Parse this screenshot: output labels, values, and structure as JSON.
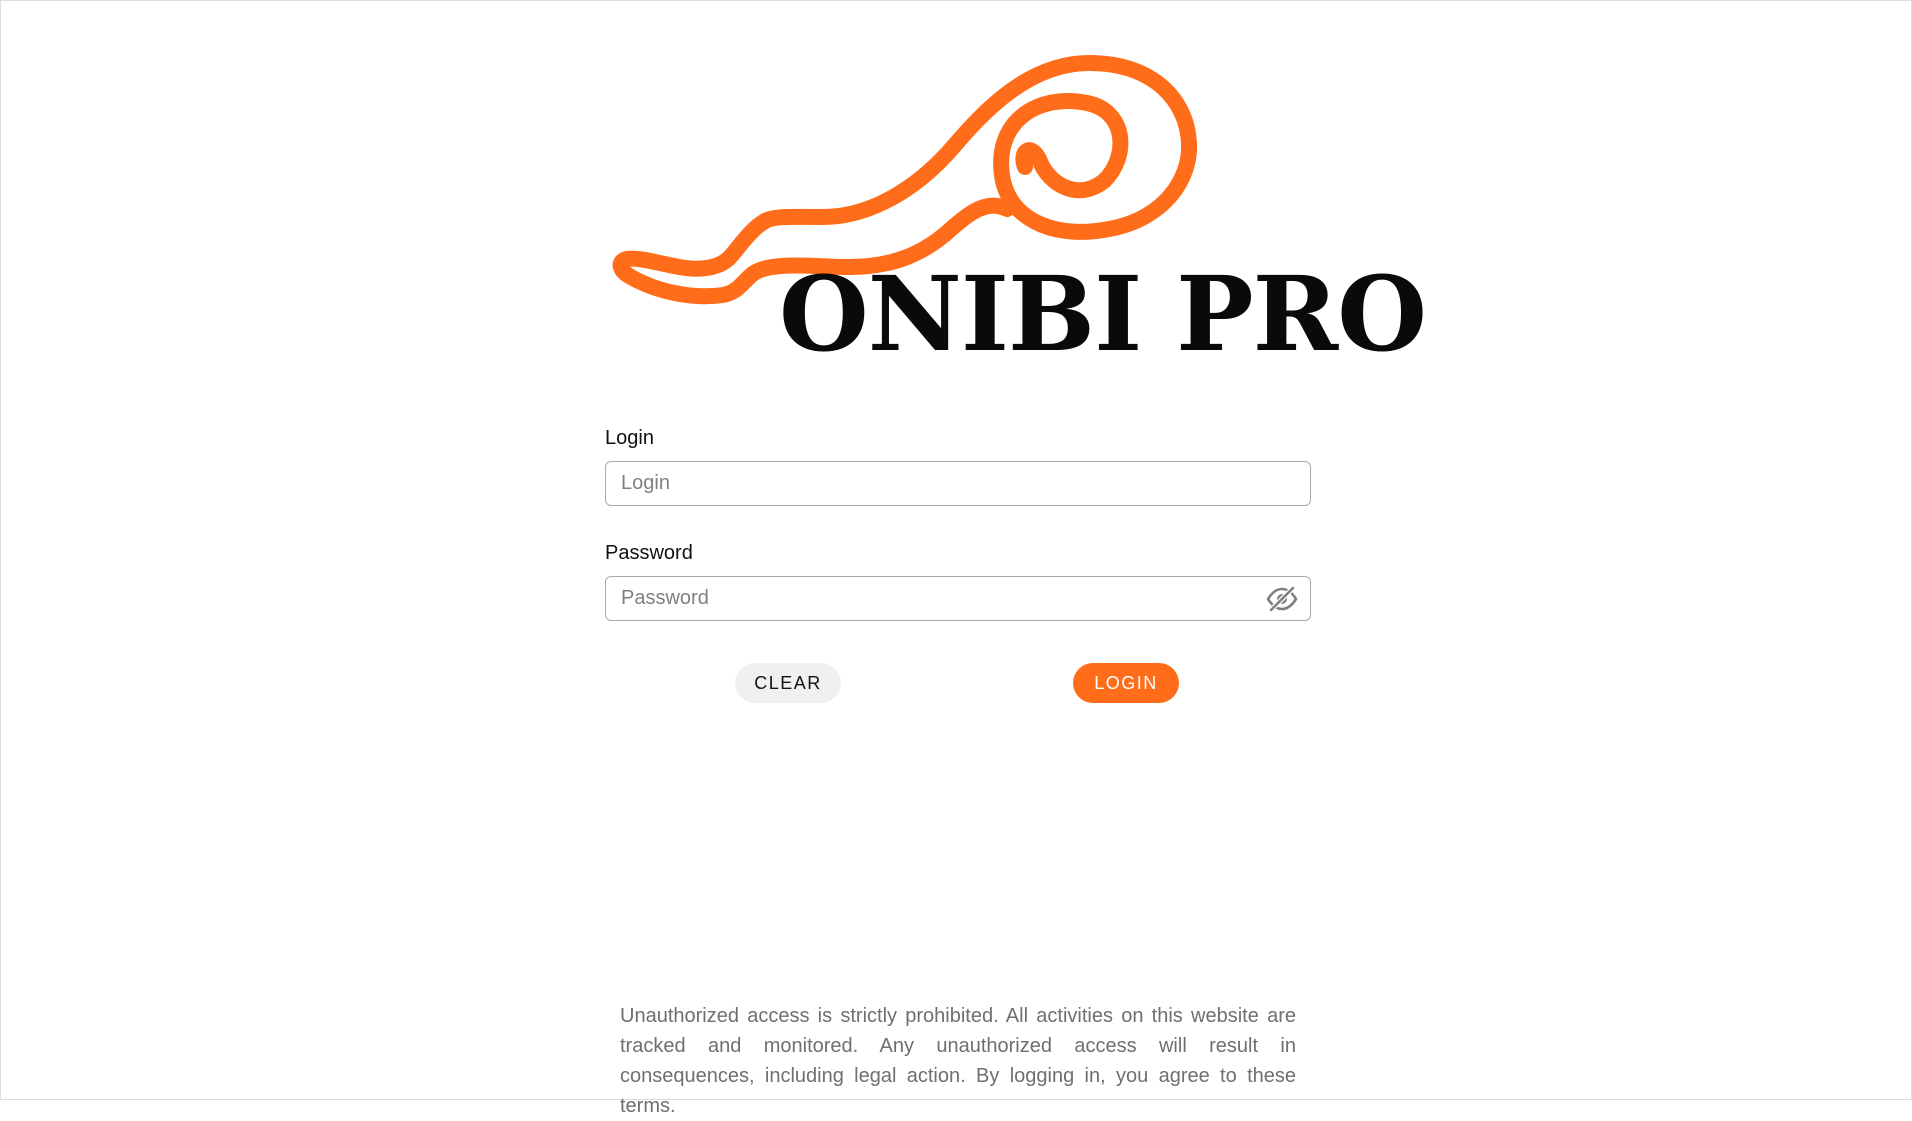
{
  "brand": {
    "name": "ONIBI PRO",
    "accent_color": "#ff6d1a",
    "logo_icon": "flame-swirl-icon"
  },
  "login_form": {
    "login_label": "Login",
    "login_placeholder": "Login",
    "login_value": "",
    "password_label": "Password",
    "password_placeholder": "Password",
    "password_value": "",
    "password_toggle_icon": "eye-slash-icon"
  },
  "actions": {
    "clear_label": "CLEAR",
    "login_label": "LOGIN"
  },
  "footer": {
    "notice": "Unauthorized access is strictly prohibited. All activities on this website are tracked and monitored. Any unauthorized access will result in consequences, including legal action. By logging in, you agree to these terms."
  }
}
